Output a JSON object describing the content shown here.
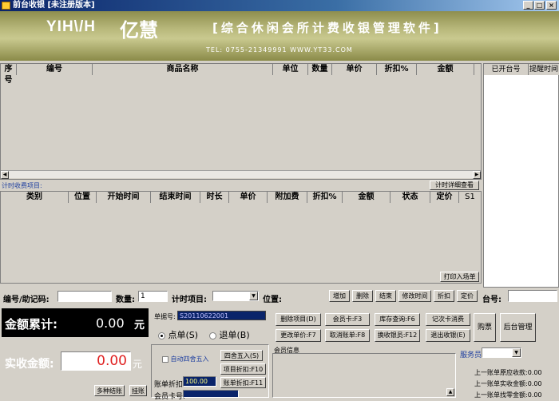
{
  "window": {
    "title": "前台收银 [未注册版本]"
  },
  "banner": {
    "logo_en": "YIH\\/H",
    "logo_cn": "亿慧",
    "slogan": "[综合休闲会所计费收银管理软件]",
    "contact": "TEL: 0755-21349991   WWW.YT33.COM"
  },
  "goods_table": {
    "headers": [
      "序号",
      "编号",
      "商品名称",
      "单位",
      "数量",
      "单价",
      "折扣%",
      "金额"
    ]
  },
  "open_tables": {
    "headers": [
      "已开台号",
      "提醒时间"
    ]
  },
  "timed_section": {
    "label": "计时收费项目:",
    "detail_button": "计时详细查看",
    "headers": [
      "类别",
      "位置",
      "开始时间",
      "结束时间",
      "时长",
      "单价",
      "附加费",
      "折扣%",
      "金额",
      "状态",
      "定价",
      "S1"
    ],
    "print_button": "打印入场单"
  },
  "entry_bar": {
    "code_label": "编号/助记码:",
    "code_value": "",
    "qty_label": "数量:",
    "qty_value": "1",
    "timed_item_label": "计时项目:",
    "position_label": "位置:",
    "buttons": [
      "增加",
      "删除",
      "结束",
      "修改时间",
      "折扣",
      "定价"
    ],
    "table_label": "台号:"
  },
  "totals": {
    "total_label": "金额累计:",
    "total_value": "0.00",
    "currency": "元",
    "received_label": "实收金额:",
    "received_value": "0.00",
    "multi_pay": "多种结账",
    "hold": "挂账"
  },
  "order": {
    "order_no_label": "单据号:",
    "order_no_value": "S20110622001",
    "mode_order": "点单(S)",
    "mode_return": "退单(B)",
    "auto_round": "自动四舍五入",
    "round_button": "四舍五入(S)",
    "item_discount": "项目折扣:F10",
    "order_discount_label": "账单折扣:",
    "order_discount_value": "100.00",
    "order_discount_button": "账单折扣:F11",
    "member_card_label": "会员卡号:"
  },
  "actions": {
    "delete_item": "删除项目(D)",
    "member_card": "会员卡:F3",
    "stock_query": "库存查询:F6",
    "timed_card": "记次卡消费",
    "change_price": "更改单价:F7",
    "cancel_order": "取消账单:F8",
    "change_cashier": "换收银员:F12",
    "logout": "退出收银(E)",
    "buy_ticket": "购票",
    "backend": "后台管理"
  },
  "member_info": {
    "label": "会员信息"
  },
  "service": {
    "staff_label": "服务员",
    "last_due": "上一账单原应收款:0.00",
    "last_received": "上一账单实收金额:0.00",
    "last_change": "上一账单找零金额:0.00"
  },
  "colors": {
    "banner": "#a6a66a",
    "total_bg": "#000000",
    "order_no_bg": "#0a246a"
  }
}
